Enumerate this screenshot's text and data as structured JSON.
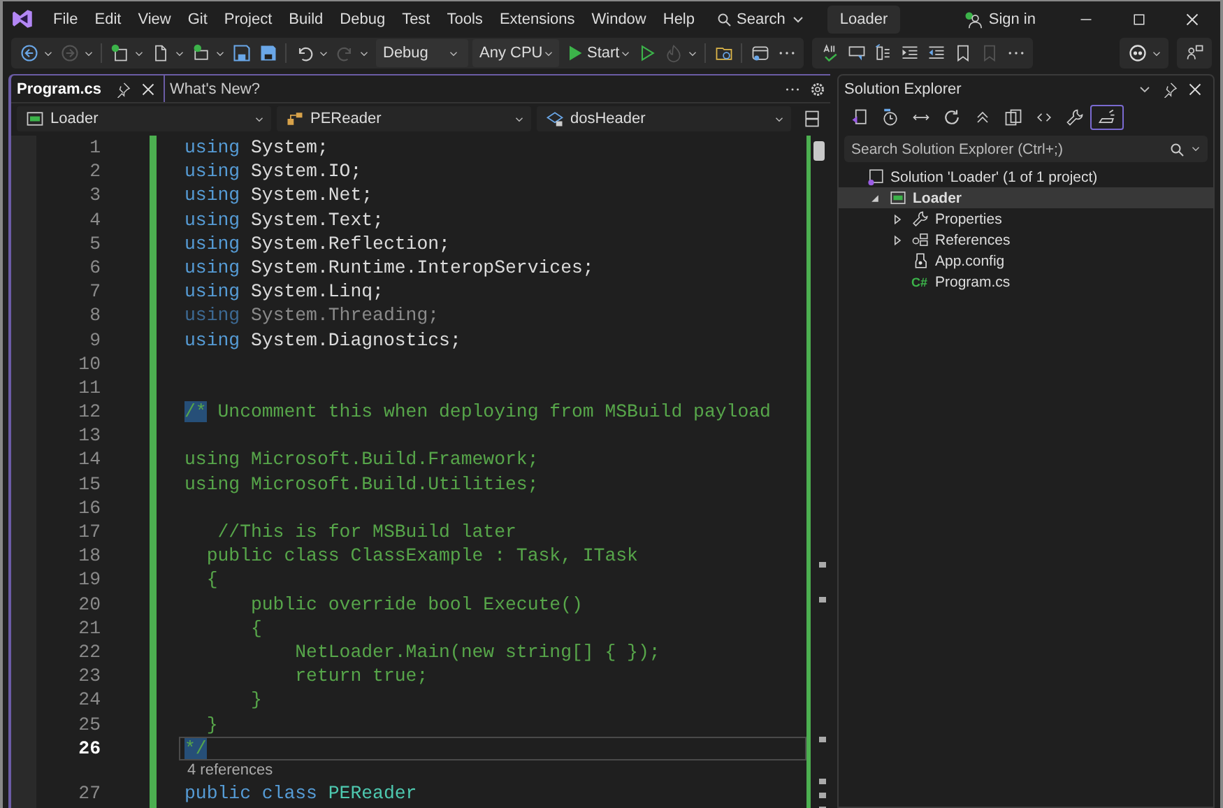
{
  "title_bar": {
    "menus": [
      "File",
      "Edit",
      "View",
      "Git",
      "Project",
      "Build",
      "Debug",
      "Test",
      "Tools",
      "Extensions",
      "Window",
      "Help"
    ],
    "search": "Search",
    "solution_name": "Loader",
    "sign_in": "Sign in"
  },
  "toolbar": {
    "configuration": "Debug",
    "platform": "Any CPU",
    "start": "Start"
  },
  "editor": {
    "tabs": [
      {
        "label": "Program.cs",
        "selected": true
      },
      {
        "label": "What's New?",
        "selected": false
      }
    ],
    "navigation": [
      "Loader",
      "PEReader",
      "dosHeader"
    ],
    "lines": [
      {
        "kind": "code",
        "number": "1",
        "current": false,
        "tokens": [
          {
            "kind": "keyword",
            "text": "using"
          },
          {
            "kind": "plain",
            "text": " System;"
          }
        ]
      },
      {
        "kind": "code",
        "number": "2",
        "current": false,
        "tokens": [
          {
            "kind": "keyword",
            "text": "using"
          },
          {
            "kind": "plain",
            "text": " System.IO;"
          }
        ]
      },
      {
        "kind": "code",
        "number": "3",
        "current": false,
        "tokens": [
          {
            "kind": "keyword",
            "text": "using"
          },
          {
            "kind": "plain",
            "text": " System.Net;"
          }
        ]
      },
      {
        "kind": "code",
        "number": "4",
        "current": false,
        "tokens": [
          {
            "kind": "keyword",
            "text": "using"
          },
          {
            "kind": "plain",
            "text": " System.Text;"
          }
        ]
      },
      {
        "kind": "code",
        "number": "5",
        "current": false,
        "tokens": [
          {
            "kind": "keyword",
            "text": "using"
          },
          {
            "kind": "plain",
            "text": " System.Reflection;"
          }
        ]
      },
      {
        "kind": "code",
        "number": "6",
        "current": false,
        "tokens": [
          {
            "kind": "keyword",
            "text": "using"
          },
          {
            "kind": "plain",
            "text": " System.Runtime.InteropServices;"
          }
        ]
      },
      {
        "kind": "code",
        "number": "7",
        "current": false,
        "tokens": [
          {
            "kind": "keyword",
            "text": "using"
          },
          {
            "kind": "plain",
            "text": " System.Linq;"
          }
        ]
      },
      {
        "kind": "code",
        "number": "8",
        "current": false,
        "tokens": [
          {
            "kind": "unused-keyword",
            "text": "using"
          },
          {
            "kind": "unused",
            "text": " System.Threading;"
          }
        ]
      },
      {
        "kind": "code",
        "number": "9",
        "current": false,
        "tokens": [
          {
            "kind": "keyword",
            "text": "using"
          },
          {
            "kind": "plain",
            "text": " System.Diagnostics;"
          }
        ]
      },
      {
        "kind": "code",
        "number": "10",
        "current": false
      },
      {
        "kind": "code",
        "number": "11",
        "current": false
      },
      {
        "kind": "code",
        "number": "12",
        "current": false,
        "tokens": [
          {
            "kind": "selection",
            "text": "/*"
          },
          {
            "kind": "comment",
            "text": " Uncomment this when deploying from MSBuild payload"
          }
        ]
      },
      {
        "kind": "code",
        "number": "13",
        "current": false
      },
      {
        "kind": "code",
        "number": "14",
        "current": false,
        "tokens": [
          {
            "kind": "comment",
            "text": "using Microsoft.Build.Framework;"
          }
        ]
      },
      {
        "kind": "code",
        "number": "15",
        "current": false,
        "tokens": [
          {
            "kind": "comment",
            "text": "using Microsoft.Build.Utilities;"
          }
        ]
      },
      {
        "kind": "code",
        "number": "16",
        "current": false
      },
      {
        "kind": "code",
        "number": "17",
        "current": false,
        "tokens": [
          {
            "kind": "comment",
            "text": "   //This is for MSBuild later"
          }
        ]
      },
      {
        "kind": "code",
        "number": "18",
        "current": false,
        "tokens": [
          {
            "kind": "comment",
            "text": "  public class ClassExample : Task, ITask"
          }
        ]
      },
      {
        "kind": "code",
        "number": "19",
        "current": false,
        "tokens": [
          {
            "kind": "comment",
            "text": "  {"
          }
        ]
      },
      {
        "kind": "code",
        "number": "20",
        "current": false,
        "tokens": [
          {
            "kind": "comment",
            "text": "      public override bool Execute()"
          }
        ]
      },
      {
        "kind": "code",
        "number": "21",
        "current": false,
        "tokens": [
          {
            "kind": "comment",
            "text": "      {"
          }
        ]
      },
      {
        "kind": "code",
        "number": "22",
        "current": false,
        "tokens": [
          {
            "kind": "comment",
            "text": "          NetLoader.Main(new string[] { });"
          }
        ]
      },
      {
        "kind": "code",
        "number": "23",
        "current": false,
        "tokens": [
          {
            "kind": "comment",
            "text": "          return true;"
          }
        ]
      },
      {
        "kind": "code",
        "number": "24",
        "current": false,
        "tokens": [
          {
            "kind": "comment",
            "text": "      }"
          }
        ]
      },
      {
        "kind": "code",
        "number": "25",
        "current": false,
        "tokens": [
          {
            "kind": "comment",
            "text": "  }"
          }
        ]
      },
      {
        "kind": "code",
        "number": "26",
        "current": true,
        "tokens": [
          {
            "kind": "selection",
            "text": "*/"
          }
        ]
      },
      {
        "kind": "codelens",
        "text": "4 references"
      },
      {
        "kind": "code",
        "number": "27",
        "current": false,
        "tokens": [
          {
            "kind": "keyword",
            "text": "public class"
          },
          {
            "kind": "type",
            "text": " PEReader"
          }
        ]
      }
    ]
  },
  "solution_explorer": {
    "title": "Solution Explorer",
    "search": {
      "placeholder": "Search Solution Explorer (Ctrl+;)"
    },
    "tree": [
      {
        "label": "Solution 'Loader' (1 of 1 project)",
        "kind": "solution",
        "selected": false,
        "children": [
          {
            "label": "Loader",
            "kind": "project",
            "selected": true,
            "expanded": true,
            "children": [
              {
                "label": "Properties",
                "kind": "properties",
                "selected": false,
                "expanded": false
              },
              {
                "label": "References",
                "kind": "references",
                "selected": false,
                "expanded": false
              },
              {
                "label": "App.config",
                "kind": "config",
                "selected": false
              },
              {
                "label": "Program.cs",
                "kind": "source",
                "badge": "C#",
                "selected": false
              }
            ]
          }
        ]
      }
    ]
  }
}
